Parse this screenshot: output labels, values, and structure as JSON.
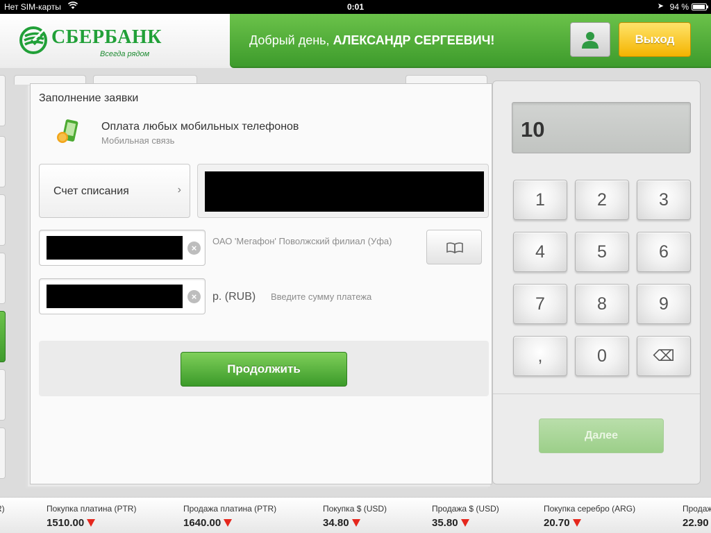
{
  "status_bar": {
    "carrier": "Нет SIM-карты",
    "time": "0:01",
    "battery": "94 %",
    "battery_level": 0.94
  },
  "header": {
    "logo_name": "СБЕРБАНК",
    "logo_tagline": "Всегда рядом",
    "greeting_prefix": "Добрый день,",
    "user_name": "АЛЕКСАНДР СЕРГЕЕВИЧ!",
    "logout_label": "Выход"
  },
  "form": {
    "title": "Заполнение заявки",
    "service_name": "Оплата любых мобильных телефонов",
    "service_category": "Мобильная связь",
    "account_label": "Счет списания",
    "operator": "ОАО 'Мегафон' Поволжский филиал (Уфа)",
    "currency": "р. (RUB)",
    "amount_hint": "Введите сумму платежа",
    "continue_label": "Продолжить"
  },
  "keypad": {
    "display_value": "10",
    "keys": [
      "1",
      "2",
      "3",
      "4",
      "5",
      "6",
      "7",
      "8",
      "9",
      ",",
      "0",
      "⌫"
    ],
    "next_label": "Далее"
  },
  "ticker": {
    "items": [
      {
        "label": "",
        "value": "",
        "edge_text": "R)"
      },
      {
        "label": "Покупка платина (PTR)",
        "value": "1510.00"
      },
      {
        "label": "Продажа платина (PTR)",
        "value": "1640.00"
      },
      {
        "label": "Покупка $ (USD)",
        "value": "34.80"
      },
      {
        "label": "Продажа $ (USD)",
        "value": "35.80"
      },
      {
        "label": "Покупка серебро (ARG)",
        "value": "20.70"
      },
      {
        "label": "Продаж",
        "value": "22.90"
      }
    ]
  },
  "colors": {
    "brand_green": "#21a038",
    "header_green": "#4fad36",
    "logout_yellow": "#f4b400",
    "down_arrow": "#e5271d"
  }
}
